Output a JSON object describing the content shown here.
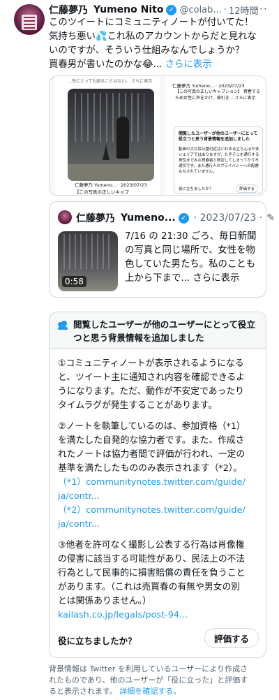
{
  "author": {
    "name": "仁藤夢乃",
    "name_en": "Yumeno Nito",
    "handle": "@colab...",
    "time": "12時間",
    "more_label": "···"
  },
  "tweet": {
    "lines": [
      "このツイートにコミュニティノートが付いてた！",
      "気持ち悪い💦これ私のアカウントからだと見れな",
      "いのですが、そういう仕組みなんでしょうか？",
      "買春男が書いたのかな😂..."
    ],
    "show_more": "さらに表示"
  },
  "media": {
    "left_caption": "…性にとっても励ることはない。 さらに表示",
    "left_mini1": "仁藤夢乃 Yumeno... · 2023/07/23",
    "left_mini2": "【この写真の正しいキャプ",
    "right_head": "仁藤夢乃 Yumeno... · 2023/07/23",
    "right_text": "【この写真の正しいキャプション】 買春するため女性に声をかけ、値引き… さらに表示",
    "note_title": "閲覧したユーザーが他のユーザーにとって役立つと思う背景情報を追加しました",
    "note_body": "動画の大久保公園付近はいわゆる立ちんぼが多いエリアではありますが、たぞそこを通行する男性までみな買春者と断定してしまってかり不適切です。また通行人のプライバシーへの配慮もなされていません。",
    "note_q": "役に立ちましたか？",
    "note_btn": "評価する"
  },
  "quote": {
    "name": "仁藤夢乃",
    "name_en": "Yumeno...",
    "date": "· 2023/07/23 ·",
    "duration": "0:58",
    "lines": [
      "7/16 の 21:30 ごろ、毎日新聞",
      "の写真と同じ場所で、女性を物",
      "色していた男たち。私のことも",
      "上から下まで..."
    ],
    "show_more": "さらに表示"
  },
  "community_note": {
    "title_lines": [
      "閲覧したユーザーが他のユーザーにとって役立",
      "つと思う背景情報を追加しました"
    ],
    "body": [
      {
        "text": "①コミュニティノートが表示されるようになる",
        "link": false
      },
      {
        "text": "と、ツイート主に通知され内容を確認できるよ",
        "link": false
      },
      {
        "text": "うになります。ただ、動作が不安定であったり",
        "link": false
      },
      {
        "text": "タイムラグが発生することがあります。",
        "link": false
      },
      {
        "text": "",
        "link": false
      },
      {
        "text": "②ノートを執筆しているのは、参加資格（*1）",
        "link": false
      },
      {
        "text": "を満たした自発的な協力者です。また、作成さ",
        "link": false
      },
      {
        "text": "れたノートは協力者間で評価が行われ、一定の",
        "link": false
      },
      {
        "text": "基準を満たしたもののみ表示されます（*2）。",
        "link": false
      },
      {
        "text": "（*1）communitynotes.twitter.com/guide/",
        "link": true
      },
      {
        "text": "ja/contr...",
        "link": true
      },
      {
        "text": "（*2）communitynotes.twitter.com/guide/",
        "link": true
      },
      {
        "text": "ja/contr...",
        "link": true
      },
      {
        "text": "",
        "link": false
      },
      {
        "text": "③他者を許可なく撮影し公表する行為は肖像権",
        "link": false
      },
      {
        "text": "の侵害に該当する可能性があり、民法上の不法",
        "link": false
      },
      {
        "text": "行為として民事的に損害賠償の責任を負うこと",
        "link": false
      },
      {
        "text": "があります。（これは売買春の有無や男女の別",
        "link": false
      },
      {
        "text": "とは関係ありません。）",
        "link": false
      },
      {
        "text": "kailash.co.jp/legals/post-94...",
        "link": true
      }
    ],
    "helpful_question": "役に立ちましたか？",
    "rate_button": "評価する"
  },
  "footer": {
    "lines": [
      "背景情報は Twitter を利用しているユーザーにより作成さ",
      "れたものであり、他のユーザーが「役に立った」と評価す"
    ],
    "last_line_text": "ると表示されます。",
    "details_link": "詳細を確認する。"
  },
  "colors": {
    "accent": "#1d9bf0",
    "text": "#0f1419",
    "secondary": "#536471",
    "border": "#cfd9de"
  }
}
